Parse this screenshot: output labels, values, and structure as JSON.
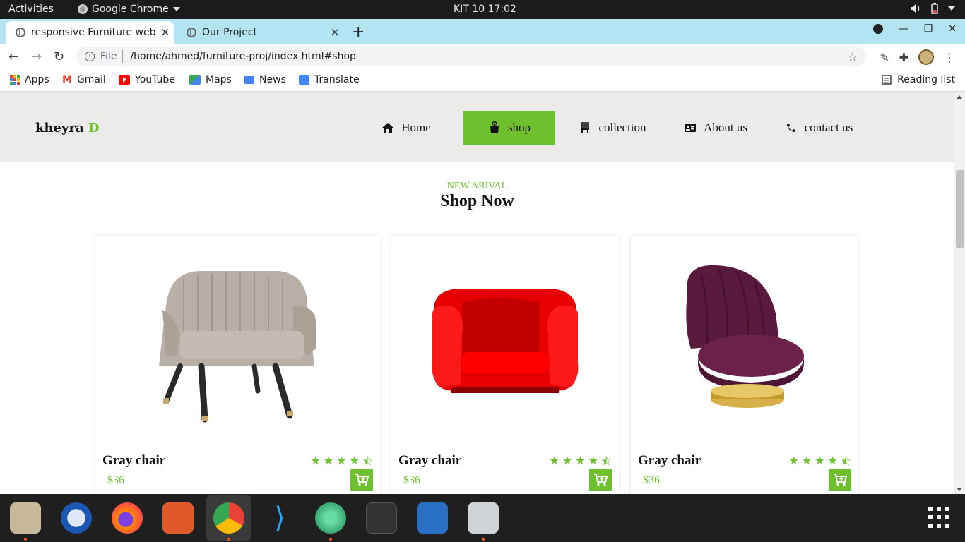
{
  "system_bar": {
    "activities": "Activities",
    "app_name": "Google Chrome",
    "clock": "KIT 10  17:02"
  },
  "browser": {
    "tabs": [
      {
        "title": "responsive Furniture web",
        "active": true
      },
      {
        "title": "Our Project",
        "active": false
      }
    ],
    "omnibox": {
      "scheme_label": "File",
      "url": "/home/ahmed/furniture-proj/index.html#shop"
    },
    "bookmarks": [
      {
        "label": "Apps",
        "icon": "apps-grid-icon"
      },
      {
        "label": "Gmail",
        "icon": "gmail-icon"
      },
      {
        "label": "YouTube",
        "icon": "youtube-icon"
      },
      {
        "label": "Maps",
        "icon": "maps-icon"
      },
      {
        "label": "News",
        "icon": "news-icon"
      },
      {
        "label": "Translate",
        "icon": "translate-icon"
      }
    ],
    "reading_list": "Reading list"
  },
  "site": {
    "logo_text": "kheyra",
    "logo_accent": "D",
    "nav": [
      {
        "label": "Home",
        "icon": "home-icon",
        "active": false
      },
      {
        "label": "shop",
        "icon": "shopping-bag-icon",
        "active": true
      },
      {
        "label": "collection",
        "icon": "chair-icon",
        "active": false
      },
      {
        "label": "About us",
        "icon": "id-card-icon",
        "active": false
      },
      {
        "label": "contact us",
        "icon": "phone-icon",
        "active": false
      }
    ],
    "kicker": "NEW ARIVAL",
    "heading": "Shop Now",
    "products": [
      {
        "name": "Gray chair",
        "price": "$36",
        "rating": 4.5,
        "image": "gray-armchair"
      },
      {
        "name": "Gray chair",
        "price": "$36",
        "rating": 4.5,
        "image": "red-armchair"
      },
      {
        "name": "Gray chair",
        "price": "$36",
        "rating": 4.5,
        "image": "purple-swivel-chair"
      }
    ]
  },
  "colors": {
    "accent": "#6fc02f",
    "header_bg": "#ecebea",
    "tabstrip_bg": "#b3e4f1"
  }
}
